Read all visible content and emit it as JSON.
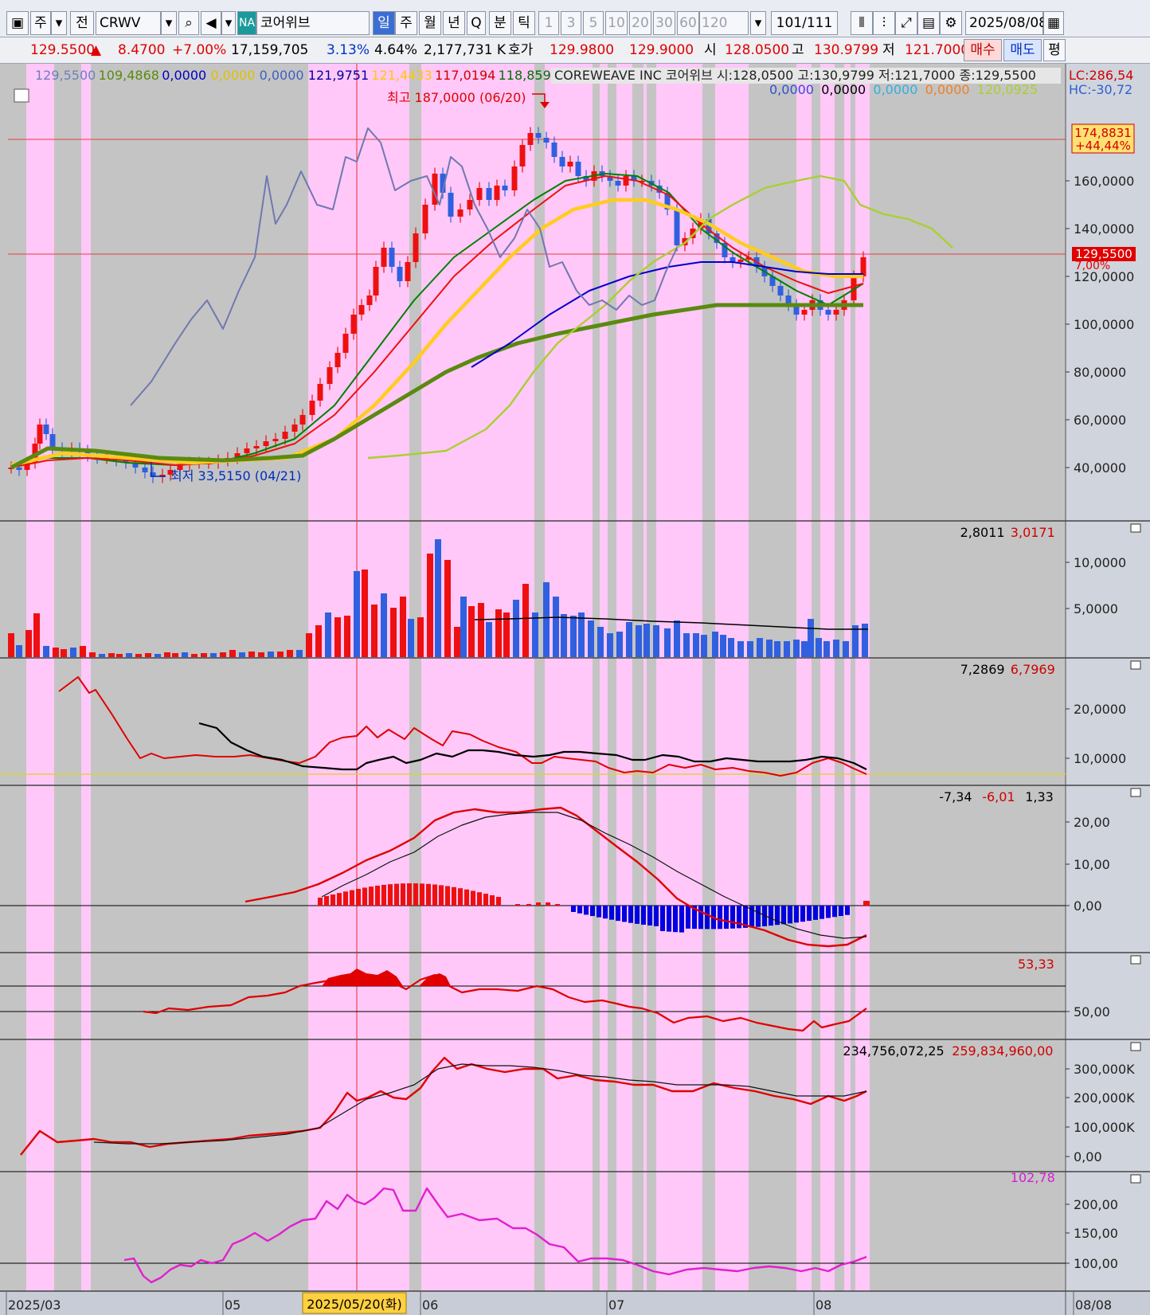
{
  "toolbar": {
    "mode1": "주",
    "mode2": "전",
    "ticker": "CRWV",
    "market_badge": "NA",
    "stock_name": "코어위브",
    "periods": [
      "일",
      "주",
      "월",
      "년",
      "Q"
    ],
    "minute_label": "분",
    "tick_label": "틱",
    "intervals": [
      "1",
      "3",
      "5",
      "10",
      "20",
      "30",
      "60",
      "120"
    ],
    "count": "101",
    "count_total": "/111",
    "date": "2025/08/08"
  },
  "quote": {
    "price": "129.5500",
    "change": "8.4700",
    "change_pct": "+7.00%",
    "volume": "17,159,705",
    "rate1": "3.13%",
    "rate2": "4.64%",
    "amount": "2,177,731 K",
    "hoga_label": "호가",
    "ask": "129.9800",
    "bid": "129.9000",
    "open_label": "시",
    "open": "128.0500",
    "high_label": "고",
    "high": "130.9799",
    "low_label": "저",
    "low": "121.7000",
    "buy_label": "매수",
    "sell_label": "매도",
    "eval_label": "평"
  },
  "legend": {
    "price_line1": [
      {
        "text": "129,5500",
        "color": "#7080c0"
      },
      {
        "text": "109,4868",
        "color": "#5a8a10"
      },
      {
        "text": "0,0000",
        "color": "#0000c0"
      },
      {
        "text": "0,0000",
        "color": "#e0c000"
      },
      {
        "text": "0,0000",
        "color": "#4060c0"
      },
      {
        "text": "121,9751",
        "color": "#0000a0"
      },
      {
        "text": "121,4433",
        "color": "#ffc800"
      },
      {
        "text": "117,0194",
        "color": "#d00000"
      },
      {
        "text": "118,8598",
        "color": "#007000"
      }
    ],
    "title": "COREWEAVE INC  코어위브 시:128,0500 고:130,9799 저:121,7000 종:129,5500",
    "price_line2": [
      {
        "text": "0,0000",
        "color": "#3050d0"
      },
      {
        "text": "0,0000",
        "color": "#000000"
      },
      {
        "text": "0,0000",
        "color": "#30b0e0"
      },
      {
        "text": "0,0000",
        "color": "#f08020"
      },
      {
        "text": "120,0925",
        "color": "#a8d030"
      }
    ],
    "lc": "LC:286,54",
    "hc": "HC:-30,72",
    "high_marker": "최고 187,0000 (06/20)",
    "low_marker": "최저 33,5150 (04/21)",
    "high_tag": "174,8831",
    "high_tag_pct": "+44,44%",
    "price_tag": "129,5500",
    "price_tag_pct": "7,00%"
  },
  "axes": {
    "price": [
      "160,0000",
      "140,0000",
      "120,0000",
      "100,0000",
      "80,0000",
      "60,0000",
      "40,0000"
    ],
    "volume": [
      "10,0000",
      "5,0000"
    ],
    "vol_ind": [
      "20,0000",
      "10,0000"
    ],
    "macd": [
      "20,00",
      "10,00",
      "0,00"
    ],
    "rsi": [
      "50,00"
    ],
    "obv": [
      "300,000K",
      "200,000K",
      "100,000K",
      "0,00"
    ],
    "cci": [
      "200,00",
      "150,00",
      "100,00"
    ],
    "dates": [
      "2025/03",
      "05",
      "06",
      "07",
      "08",
      "08/08"
    ],
    "cursor_date": "2025/05/20(화)"
  },
  "panels": {
    "volume_vals": [
      {
        "text": "2,8011",
        "color": "#000"
      },
      {
        "text": "3,0171",
        "color": "#d00000"
      }
    ],
    "vol_ind_vals": [
      {
        "text": "7,2869",
        "color": "#000"
      },
      {
        "text": "6,7969",
        "color": "#d00000"
      }
    ],
    "macd_vals": [
      {
        "text": "-7,34",
        "color": "#000"
      },
      {
        "text": "-6,01",
        "color": "#d00000"
      },
      {
        "text": "1,33",
        "color": "#000"
      }
    ],
    "rsi_vals": [
      {
        "text": "53,33",
        "color": "#d00000"
      }
    ],
    "obv_vals": [
      {
        "text": "234,756,072,25",
        "color": "#000"
      },
      {
        "text": "259,834,960,00",
        "color": "#d00000"
      }
    ],
    "cci_vals": [
      {
        "text": "102,78",
        "color": "#d020d0"
      }
    ]
  },
  "colors": {
    "up": "#ee1010",
    "down": "#3060e0",
    "pink_band": "#ffc8f8",
    "gray_band": "#c4c4c4"
  }
}
